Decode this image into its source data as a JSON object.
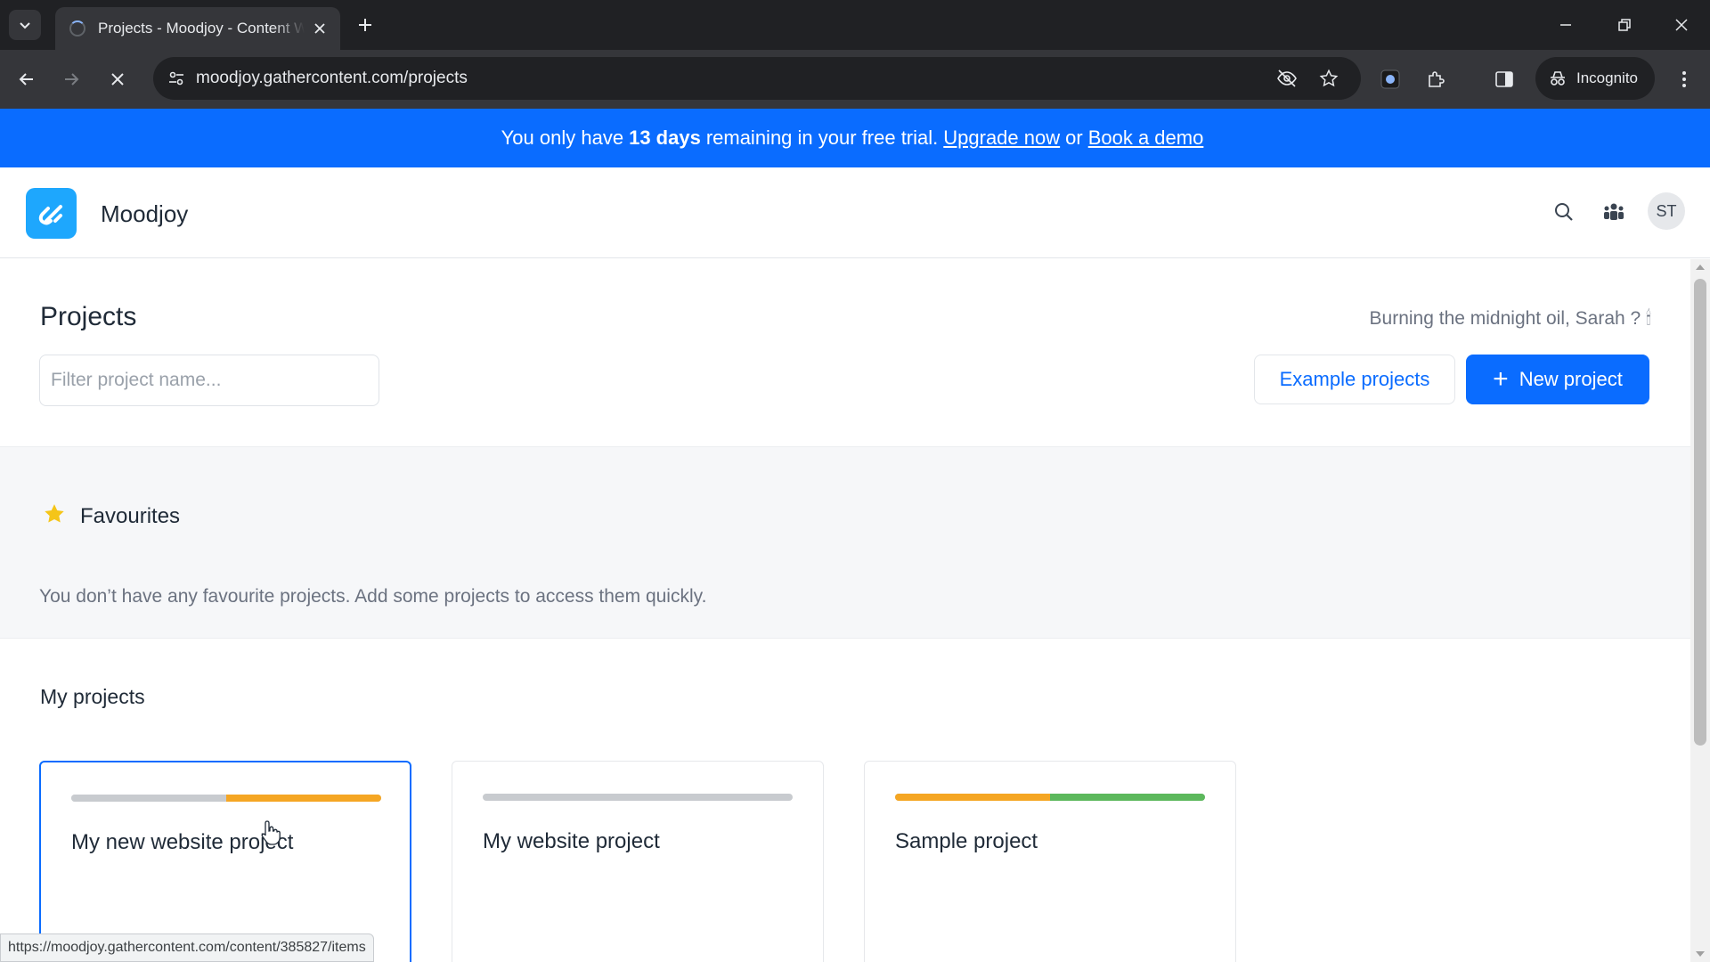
{
  "browser": {
    "tab_title": "Projects - Moodjoy - Content W",
    "url": "moodjoy.gathercontent.com/projects",
    "incognito_label": "Incognito",
    "status_url": "https://moodjoy.gathercontent.com/content/385827/items"
  },
  "banner": {
    "prefix": "You only have",
    "days": "13 days",
    "middle": "remaining in your free trial.",
    "upgrade_link": "Upgrade now",
    "or_text": "or",
    "demo_link": "Book a demo",
    "color": "#0a6cff"
  },
  "header": {
    "org_name": "Moodjoy",
    "avatar_initials": "ST",
    "logo_color": "#1ea7fd"
  },
  "page": {
    "title": "Projects",
    "greeting": "Burning the midnight oil, Sarah ? 🕯",
    "filter_placeholder": "Filter project name...",
    "example_button": "Example projects",
    "new_button": "New project"
  },
  "favourites": {
    "title": "Favourites",
    "empty_message": "You don’t have any favourite projects. Add some projects to access them quickly."
  },
  "my_projects": {
    "title": "My projects",
    "projects": [
      {
        "name": "My new website project",
        "progress": [
          {
            "fraction": 0.5,
            "color": "#c8cbcf"
          },
          {
            "fraction": 0.5,
            "color": "#f5a623"
          }
        ]
      },
      {
        "name": "My website project",
        "progress": [
          {
            "fraction": 1.0,
            "color": "#c8cbcf"
          }
        ]
      },
      {
        "name": "Sample project",
        "progress": [
          {
            "fraction": 0.5,
            "color": "#f5a623"
          },
          {
            "fraction": 0.5,
            "color": "#5cb85c"
          }
        ]
      }
    ]
  }
}
